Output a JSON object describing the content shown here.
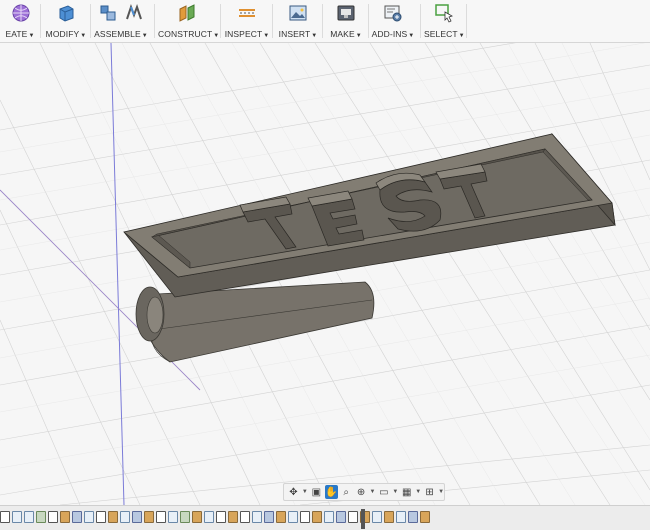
{
  "toolbar": {
    "groups": [
      {
        "id": "create",
        "label": "EATE"
      },
      {
        "id": "modify",
        "label": "MODIFY"
      },
      {
        "id": "assemble",
        "label": "ASSEMBLE"
      },
      {
        "id": "construct",
        "label": "CONSTRUCT"
      },
      {
        "id": "inspect",
        "label": "INSPECT"
      },
      {
        "id": "insert",
        "label": "INSERT"
      },
      {
        "id": "make",
        "label": "MAKE"
      },
      {
        "id": "addins",
        "label": "ADD-INS"
      },
      {
        "id": "select",
        "label": "SELECT"
      }
    ]
  },
  "model": {
    "embossed_text": "TEST",
    "body_color": "#6f6b62"
  },
  "navbar": {
    "tools": [
      "orbit-icon",
      "look-at-icon",
      "pan-icon",
      "zoom-icon",
      "fit-icon",
      "display-settings-icon",
      "grid-icon",
      "viewports-icon"
    ],
    "active": "pan-icon"
  },
  "timeline": {
    "items": [
      "ax",
      "sk",
      "sk",
      "pl",
      "ax",
      "ex",
      "fi",
      "sk",
      "ax",
      "ex",
      "sk",
      "fi",
      "ex",
      "ax",
      "sk",
      "pl",
      "ex",
      "sk",
      "ax",
      "ex",
      "ax",
      "sk",
      "fi",
      "ex",
      "sk",
      "ax",
      "ex",
      "sk",
      "fi",
      "ax",
      "ex",
      "sk",
      "ex",
      "sk",
      "fi",
      "ex"
    ]
  }
}
